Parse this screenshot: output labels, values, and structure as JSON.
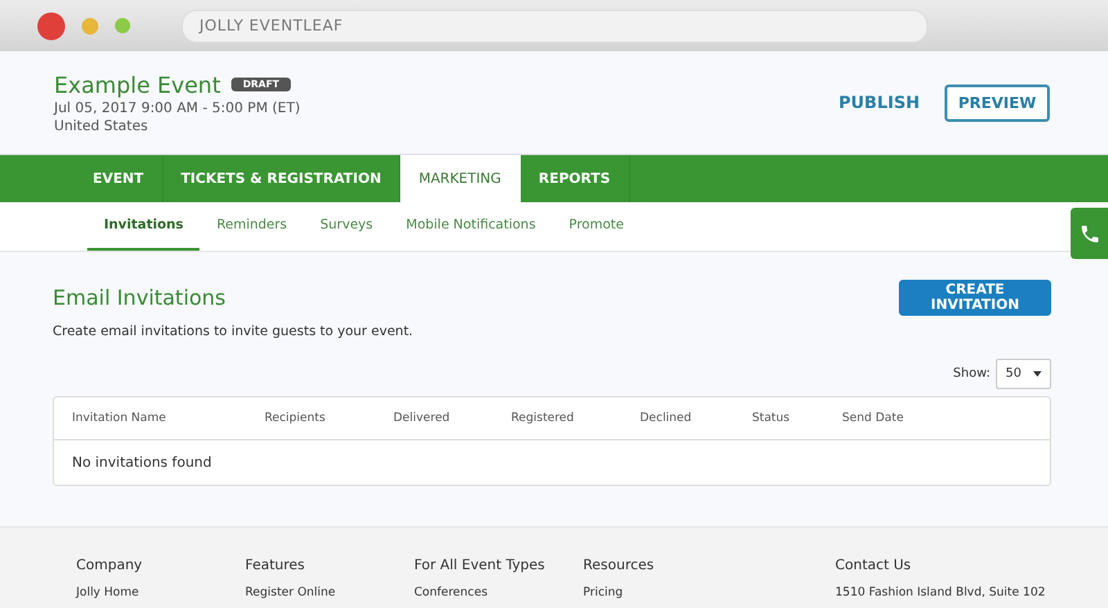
{
  "window": {
    "title": "JOLLY EVENTLEAF"
  },
  "event": {
    "name": "Example Event",
    "badge": "DRAFT",
    "date": "Jul 05, 2017 9:00 AM - 5:00 PM (ET)",
    "location": "United States"
  },
  "actions": {
    "publish": "PUBLISH",
    "preview": "PREVIEW"
  },
  "tabs": [
    {
      "label": "EVENT",
      "selected": false
    },
    {
      "label": "TICKETS & REGISTRATION",
      "selected": false
    },
    {
      "label": "MARKETING",
      "selected": true
    },
    {
      "label": "REPORTS",
      "selected": false
    }
  ],
  "subtabs": [
    {
      "label": "Invitations",
      "selected": true
    },
    {
      "label": "Reminders",
      "selected": false
    },
    {
      "label": "Surveys",
      "selected": false
    },
    {
      "label": "Mobile Notifications",
      "selected": false
    },
    {
      "label": "Promote",
      "selected": false
    }
  ],
  "section": {
    "title": "Email Invitations",
    "description": "Create email invitations to invite guests to your event.",
    "create_button": "CREATE INVITATION"
  },
  "show": {
    "label": "Show:",
    "value": "50"
  },
  "table": {
    "columns": [
      "Invitation Name",
      "Recipients",
      "Delivered",
      "Registered",
      "Declined",
      "Status",
      "Send Date"
    ],
    "empty": "No invitations found"
  },
  "footer": {
    "columns": [
      {
        "heading": "Company",
        "items": [
          "Jolly Home"
        ]
      },
      {
        "heading": "Features",
        "items": [
          "Register Online"
        ]
      },
      {
        "heading": "For All Event Types",
        "items": [
          "Conferences"
        ]
      },
      {
        "heading": "Resources",
        "items": [
          "Pricing"
        ]
      },
      {
        "heading": "Contact Us",
        "items": [
          "1510 Fashion Island Blvd, Suite 102"
        ]
      }
    ]
  }
}
